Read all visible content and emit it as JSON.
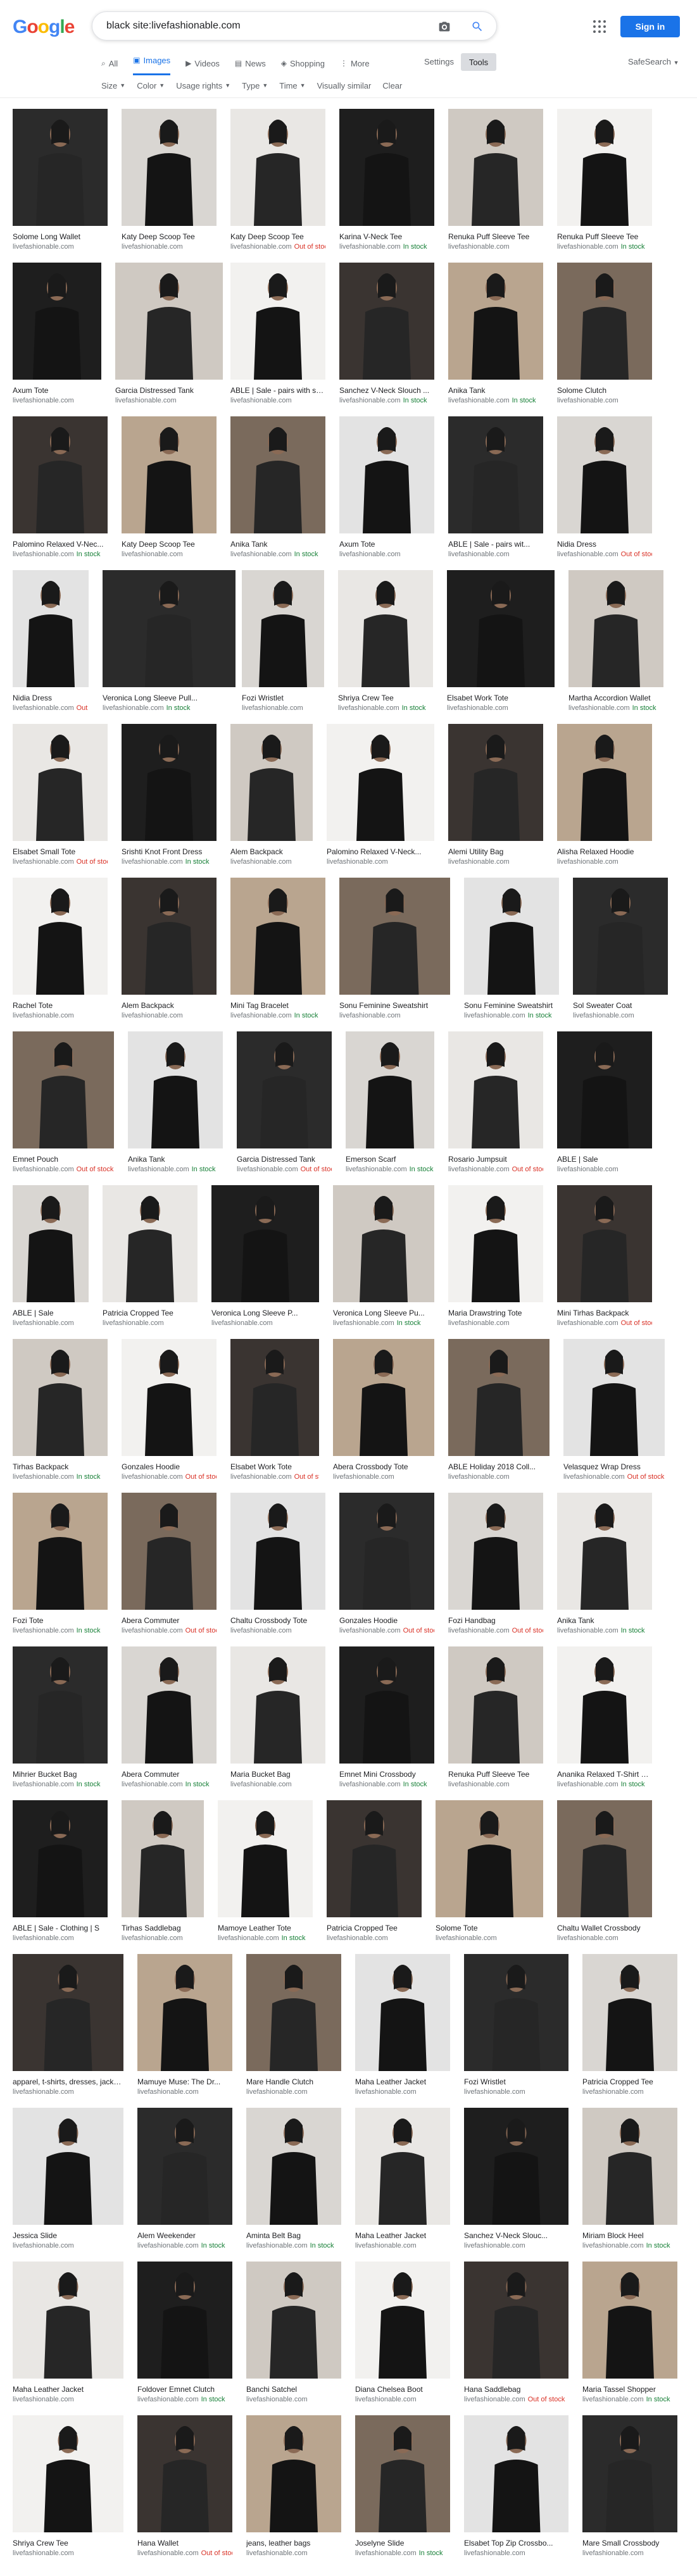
{
  "search": {
    "query": "black site:livefashionable.com"
  },
  "brand": {
    "logo_letters": [
      "G",
      "o",
      "o",
      "g",
      "l",
      "e"
    ],
    "logo_colors": [
      "#4285f4",
      "#ea4335",
      "#fbbc05",
      "#4285f4",
      "#34a853",
      "#ea4335"
    ]
  },
  "header": {
    "signin_label": "Sign in",
    "settings_label": "Settings",
    "tools_label": "Tools",
    "safesearch_label": "SafeSearch"
  },
  "tabs": [
    {
      "label": "All",
      "icon": "search-icon",
      "active": false
    },
    {
      "label": "Images",
      "icon": "image-icon",
      "active": true
    },
    {
      "label": "Videos",
      "icon": "video-icon",
      "active": false
    },
    {
      "label": "News",
      "icon": "news-icon",
      "active": false
    },
    {
      "label": "Shopping",
      "icon": "tag-icon",
      "active": false
    },
    {
      "label": "More",
      "icon": "more-icon",
      "active": false
    }
  ],
  "filters": [
    "Size",
    "Color",
    "Usage rights",
    "Type",
    "Time",
    "Visually similar",
    "Clear"
  ],
  "source": "livefashionable.com",
  "status_labels": {
    "in": "In stock",
    "out": "Out of stock"
  },
  "rows": [
    [
      {
        "t": "Solome Long Wallet",
        "s": ""
      },
      {
        "t": "Katy Deep Scoop Tee",
        "s": ""
      },
      {
        "t": "Katy Deep Scoop Tee",
        "s": "out"
      },
      {
        "t": "Karina V-Neck Tee",
        "s": "in"
      },
      {
        "t": "Renuka Puff Sleeve Tee",
        "s": ""
      },
      {
        "t": "Renuka Puff Sleeve Tee",
        "s": "in"
      }
    ],
    [
      {
        "t": "Axum Tote",
        "s": ""
      },
      {
        "t": "Garcia Distressed Tank",
        "s": ""
      },
      {
        "t": "ABLE | Sale - pairs with se...",
        "s": ""
      },
      {
        "t": "Sanchez V-Neck Slouch ...",
        "s": "in"
      },
      {
        "t": "Anika Tank",
        "s": "in"
      },
      {
        "t": "Solome Clutch",
        "s": ""
      }
    ],
    [
      {
        "t": "Palomino Relaxed V-Nec...",
        "s": "in"
      },
      {
        "t": "Katy Deep Scoop Tee",
        "s": ""
      },
      {
        "t": "Anika Tank",
        "s": "in"
      },
      {
        "t": "Axum Tote",
        "s": ""
      },
      {
        "t": "ABLE | Sale - pairs wit...",
        "s": ""
      },
      {
        "t": "Nidia Dress",
        "s": "out"
      }
    ],
    [
      {
        "t": "Nidia Dress",
        "s": "out"
      },
      {
        "t": "Veronica Long Sleeve Pull...",
        "s": "in"
      },
      {
        "t": "Fozi Wristlet",
        "s": ""
      },
      {
        "t": "Shriya Crew Tee",
        "s": "in"
      },
      {
        "t": "Elsabet Work Tote",
        "s": ""
      },
      {
        "t": "Martha Accordion Wallet",
        "s": "in"
      }
    ],
    [
      {
        "t": "Elsabet Small Tote",
        "s": "out"
      },
      {
        "t": "Srishti Knot Front Dress",
        "s": "in"
      },
      {
        "t": "Alem Backpack",
        "s": ""
      },
      {
        "t": "Palomino Relaxed V-Neck...",
        "s": ""
      },
      {
        "t": "Alemi Utility Bag",
        "s": ""
      },
      {
        "t": "Alisha Relaxed Hoodie",
        "s": ""
      }
    ],
    [
      {
        "t": "Rachel Tote",
        "s": ""
      },
      {
        "t": "Alem Backpack",
        "s": ""
      },
      {
        "t": "Mini Tag Bracelet",
        "s": "in"
      },
      {
        "t": "Sonu Feminine Sweatshirt",
        "s": ""
      },
      {
        "t": "Sonu Feminine Sweatshirt",
        "s": "in"
      },
      {
        "t": "Sol Sweater Coat",
        "s": ""
      }
    ],
    [
      {
        "t": "Emnet Pouch",
        "s": "out"
      },
      {
        "t": "Anika Tank",
        "s": "in"
      },
      {
        "t": "Garcia Distressed Tank",
        "s": "out"
      },
      {
        "t": "Emerson Scarf",
        "s": "in"
      },
      {
        "t": "Rosario Jumpsuit",
        "s": "out"
      },
      {
        "t": "ABLE | Sale",
        "s": ""
      }
    ],
    [
      {
        "t": "ABLE | Sale",
        "s": ""
      },
      {
        "t": "Patricia Cropped Tee",
        "s": ""
      },
      {
        "t": "Veronica Long Sleeve P...",
        "s": ""
      },
      {
        "t": "Veronica Long Sleeve Pu...",
        "s": "in"
      },
      {
        "t": "Maria Drawstring Tote",
        "s": ""
      },
      {
        "t": "Mini Tirhas Backpack",
        "s": "out"
      }
    ],
    [
      {
        "t": "Tirhas Backpack",
        "s": "in"
      },
      {
        "t": "Gonzales Hoodie",
        "s": "out"
      },
      {
        "t": "Elsabet Work Tote",
        "s": "out"
      },
      {
        "t": "Abera Crossbody Tote",
        "s": ""
      },
      {
        "t": "ABLE Holiday 2018 Coll...",
        "s": ""
      },
      {
        "t": "Velasquez Wrap Dress",
        "s": "out"
      }
    ],
    [
      {
        "t": "Fozi Tote",
        "s": "in"
      },
      {
        "t": "Abera Commuter",
        "s": "out"
      },
      {
        "t": "Chaltu Crossbody Tote",
        "s": ""
      },
      {
        "t": "Gonzales Hoodie",
        "s": "out"
      },
      {
        "t": "Fozi Handbag",
        "s": "out"
      },
      {
        "t": "Anika Tank",
        "s": "in"
      }
    ],
    [
      {
        "t": "Mihrier Bucket Bag",
        "s": "in"
      },
      {
        "t": "Abera Commuter",
        "s": "in"
      },
      {
        "t": "Maria Bucket Bag",
        "s": ""
      },
      {
        "t": "Emnet Mini Crossbody",
        "s": "in"
      },
      {
        "t": "Renuka Puff Sleeve Tee",
        "s": ""
      },
      {
        "t": "Ananika Relaxed T-Shirt Dress",
        "s": "in"
      }
    ],
    [
      {
        "t": "ABLE | Sale - Clothing | S",
        "s": ""
      },
      {
        "t": "Tirhas Saddlebag",
        "s": ""
      },
      {
        "t": "Mamoye Leather Tote",
        "s": "in"
      },
      {
        "t": "Patricia Cropped Tee",
        "s": ""
      },
      {
        "t": "Solome Tote",
        "s": ""
      },
      {
        "t": "Chaltu Wallet Crossbody",
        "s": ""
      }
    ],
    [
      {
        "t": "apparel, t-shirts, dresses, jacket...",
        "s": ""
      },
      {
        "t": "Mamuye Muse: The Dr...",
        "s": ""
      },
      {
        "t": "Mare Handle Clutch",
        "s": ""
      },
      {
        "t": "Maha Leather Jacket",
        "s": ""
      },
      {
        "t": "Fozi Wristlet",
        "s": ""
      },
      {
        "t": "Patricia Cropped Tee",
        "s": ""
      }
    ],
    [
      {
        "t": "Jessica Slide",
        "s": ""
      },
      {
        "t": "Alem Weekender",
        "s": "in"
      },
      {
        "t": "Aminta Belt Bag",
        "s": "in"
      },
      {
        "t": "Maha Leather Jacket",
        "s": ""
      },
      {
        "t": "Sanchez V-Neck Slouc...",
        "s": ""
      },
      {
        "t": "Miriam Block Heel",
        "s": "in"
      }
    ],
    [
      {
        "t": "Maha Leather Jacket",
        "s": ""
      },
      {
        "t": "Foldover Emnet Clutch",
        "s": "in"
      },
      {
        "t": "Banchi Satchel",
        "s": ""
      },
      {
        "t": "Diana Chelsea Boot",
        "s": ""
      },
      {
        "t": "Hana Saddlebag",
        "s": "out"
      },
      {
        "t": "Maria Tassel Shopper",
        "s": "in"
      }
    ],
    [
      {
        "t": "Shriya Crew Tee",
        "s": ""
      },
      {
        "t": "Hana Wallet",
        "s": "out"
      },
      {
        "t": "jeans, leather bags",
        "s": ""
      },
      {
        "t": "Joselyne Slide",
        "s": "in"
      },
      {
        "t": "Elsabet Top Zip Crossbo...",
        "s": ""
      },
      {
        "t": "Mare Small Crossbody",
        "s": ""
      }
    ]
  ],
  "colors": {
    "accent": "#1a73e8",
    "in_stock": "#188038",
    "out_of_stock": "#d93025"
  }
}
